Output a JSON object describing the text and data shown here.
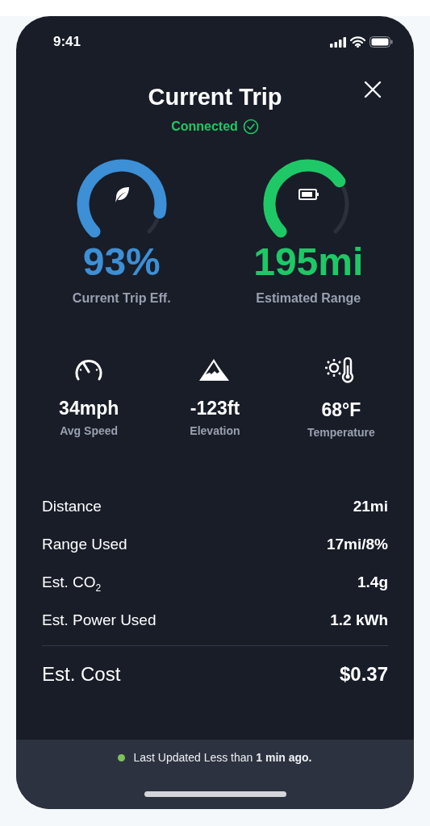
{
  "status_bar": {
    "time": "9:41"
  },
  "header": {
    "title": "Current Trip",
    "status": "Connected"
  },
  "gauges": [
    {
      "kind": "efficiency",
      "value": "93%",
      "label": "Current Trip Eff.",
      "color": "#3d8fd6"
    },
    {
      "kind": "range",
      "value": "195mi",
      "label": "Estimated Range",
      "color": "#1fc866"
    }
  ],
  "stats": [
    {
      "kind": "speed",
      "value": "34mph",
      "label": "Avg Speed"
    },
    {
      "kind": "elevation",
      "value": "-123ft",
      "label": "Elevation"
    },
    {
      "kind": "temperature",
      "value": "68°F",
      "label": "Temperature"
    }
  ],
  "details": [
    {
      "label": "Distance",
      "value": "21mi"
    },
    {
      "label": "Range Used",
      "value": "17mi/8%"
    },
    {
      "label": "Est. CO$_{2}$",
      "value": "1.4g"
    },
    {
      "label": "Est. Power Used",
      "value": "1.2 kWh"
    }
  ],
  "total": {
    "label": "Est. Cost",
    "value": "$0.37"
  },
  "footer": {
    "text": "Last Updated Less than **1 min ago.**",
    "color": "#7cc35a"
  }
}
